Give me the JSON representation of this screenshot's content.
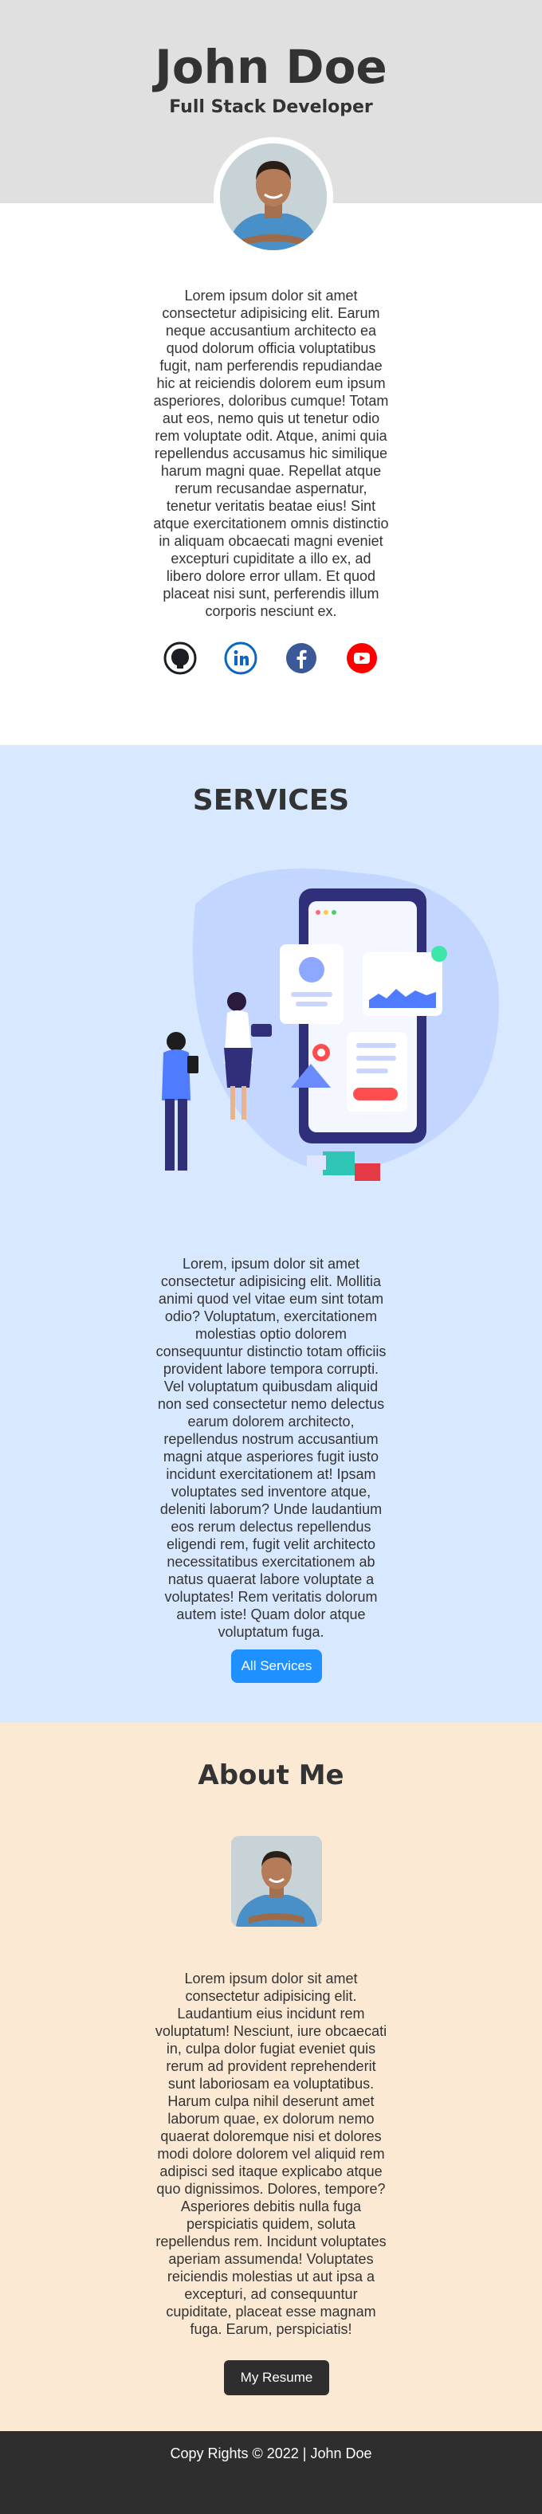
{
  "header": {
    "name": "John Doe",
    "role": "Full Stack Developer",
    "bio": "Lorem ipsum dolor sit amet consectetur adipisicing elit. Earum neque accusantium architecto ea quod dolorum officia voluptatibus fugit, nam perferendis repudiandae hic at reiciendis dolorem eum ipsum asperiores, doloribus cumque! Totam aut eos, nemo quis ut tenetur odio rem voluptate odit. Atque, animi quia repellendus accusamus hic similique harum magni quae. Repellat atque rerum recusandae aspernatur, tenetur veritatis beatae eius! Sint atque exercitationem omnis distinctio in aliquam obcaecati magni eveniet excepturi cupiditate a illo ex, ad libero dolore error ullam. Et quod placeat nisi sunt, perferendis illum corporis nesciunt ex."
  },
  "social": [
    {
      "icon": "github-icon",
      "color": "#1b1f23"
    },
    {
      "icon": "linkedin-icon",
      "color": "#0a66c2"
    },
    {
      "icon": "facebook-icon",
      "color": "#3b5998"
    },
    {
      "icon": "youtube-icon",
      "color": "#ff0000"
    }
  ],
  "services": {
    "title": "SERVICES",
    "text": "Lorem, ipsum dolor sit amet consectetur adipisicing elit. Mollitia animi quod vel vitae eum sint totam odio? Voluptatum, exercitationem molestias optio dolorem consequuntur distinctio totam officiis provident labore tempora corrupti. Vel voluptatum quibusdam aliquid non sed consectetur nemo delectus earum dolorem architecto, repellendus nostrum accusantium magni atque asperiores fugit iusto incidunt exercitationem at! Ipsam voluptates sed inventore atque, deleniti laborum? Unde laudantium eos rerum delectus repellendus eligendi rem, fugit velit architecto necessitatibus exercitationem ab natus quaerat labore voluptate a voluptates! Rem veritatis dolorum autem iste! Quam dolor atque voluptatum fuga.",
    "button": "All Services"
  },
  "about": {
    "title": "About Me",
    "text": "Lorem ipsum dolor sit amet consectetur adipisicing elit. Laudantium eius incidunt rem voluptatum! Nesciunt, iure obcaecati in, culpa dolor fugiat eveniet quis rerum ad provident reprehenderit sunt laboriosam ea voluptatibus. Harum culpa nihil deserunt amet laborum quae, ex dolorum nemo quaerat doloremque nisi et dolores modi dolore dolorem vel aliquid rem adipisci sed itaque explicabo atque quo dignissimos. Dolores, tempore? Asperiores debitis nulla fuga perspiciatis quidem, soluta repellendus rem. Incidunt voluptates aperiam assumenda! Voluptates reiciendis molestias ut aut ipsa a excepturi, ad consequuntur cupiditate, placeat esse magnam fuga. Earum, perspiciatis!",
    "button": "My Resume"
  },
  "footer": {
    "text": "Copy Rights © 2022 | John Doe"
  },
  "colors": {
    "header_bg": "#e0e0e0",
    "services_bg": "#d8e8ff",
    "about_bg": "#fbe9d4",
    "accent_button": "#1e90ff",
    "dark": "#2e2e2e"
  }
}
